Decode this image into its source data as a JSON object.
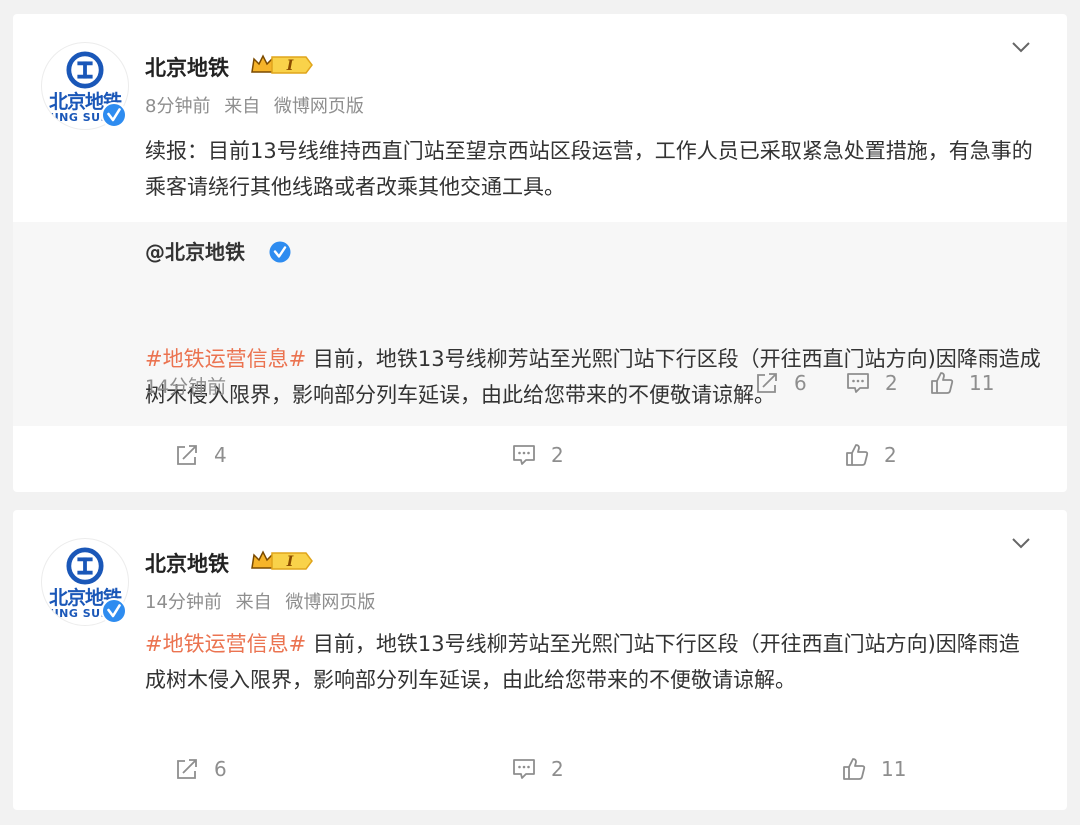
{
  "colors": {
    "hashtag": "#eb7350",
    "brand_blue": "#1a57b8",
    "verified": "#2e8cf0",
    "vip_gold": "#f6b42a",
    "meta_gray": "#8e8e8e"
  },
  "posts": [
    {
      "author": "北京地铁",
      "avatar": {
        "cn_text": "北京地铁",
        "en_text": "JING SUI"
      },
      "time": "8分钟前",
      "source_prefix": "来自",
      "source": "微博网页版",
      "hashtag": "",
      "text": "续报：目前13号线维持西直门站至望京西站区段运营，工作人员已采取紧急处置措施，有急事的乘客请绕行其他线路或者改乘其他交通工具。",
      "retweeted": {
        "author": "@北京地铁",
        "hashtag": "#地铁运营信息#",
        "text": " 目前，地铁13号线柳芳站至光熙门站下行区段（开往西直门站方向)因降雨造成树木侵入限界，影响部分列车延误，由此给您带来的不便敬请谅解。",
        "time": "14分钟前",
        "reposts": "6",
        "comments": "2",
        "likes": "11"
      },
      "reposts": "4",
      "comments": "2",
      "likes": "2"
    },
    {
      "author": "北京地铁",
      "avatar": {
        "cn_text": "北京地铁",
        "en_text": "JING SUI"
      },
      "time": "14分钟前",
      "source_prefix": "来自",
      "source": "微博网页版",
      "hashtag": "#地铁运营信息#",
      "text": " 目前，地铁13号线柳芳站至光熙门站下行区段（开往西直门站方向)因降雨造成树木侵入限界，影响部分列车延误，由此给您带来的不便敬请谅解。",
      "reposts": "6",
      "comments": "2",
      "likes": "11"
    }
  ],
  "icons": [
    "beijing-subway-logo-icon",
    "verified-icon",
    "vip-level-icon",
    "chevron-down-icon",
    "repost-icon",
    "comment-icon",
    "like-icon"
  ]
}
